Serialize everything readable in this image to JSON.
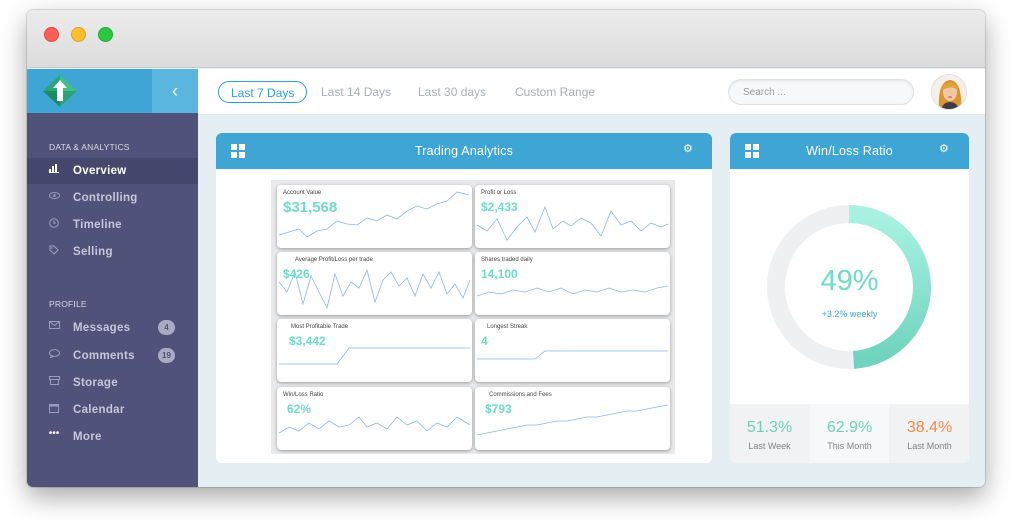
{
  "window": {
    "title": ""
  },
  "sidebar": {
    "sections": [
      {
        "label": "DATA & ANALYTICS",
        "items": [
          {
            "label": "Overview",
            "icon": "bar-chart-icon",
            "active": true
          },
          {
            "label": "Controlling",
            "icon": "eye-icon"
          },
          {
            "label": "Timeline",
            "icon": "clock-icon"
          },
          {
            "label": "Selling",
            "icon": "tag-icon"
          }
        ]
      },
      {
        "label": "PROFILE",
        "items": [
          {
            "label": "Messages",
            "icon": "envelope-icon",
            "badge": "4"
          },
          {
            "label": "Comments",
            "icon": "speech-bubble-icon",
            "badge": "19"
          },
          {
            "label": "Storage",
            "icon": "box-icon"
          },
          {
            "label": "Calendar",
            "icon": "calendar-icon"
          },
          {
            "label": "More",
            "icon": "ellipsis-icon"
          }
        ]
      }
    ],
    "collapse_icon": "‹"
  },
  "header": {
    "tabs": [
      {
        "label": "Last 7 Days",
        "active": true
      },
      {
        "label": "Last 14 Days"
      },
      {
        "label": "Last 30 days"
      },
      {
        "label": "Custom Range"
      }
    ],
    "search_placeholder": "Search ..."
  },
  "trading": {
    "title": "Trading Analytics",
    "cards": [
      {
        "label": "Account Value",
        "value": "$31,568"
      },
      {
        "label": "Profit or Loss",
        "value": "$2,433"
      },
      {
        "label": "Average Profit/Loss per trade",
        "value": "$426"
      },
      {
        "label": "Shares traded daily",
        "value": "14,100"
      },
      {
        "label": "Most Profitable Trade",
        "value": "$3,442"
      },
      {
        "label": "Longest Streak",
        "value": "4"
      },
      {
        "label": "Win/Loss Ratio",
        "value": "62%"
      },
      {
        "label": "Commissions and Fees",
        "value": "$793"
      }
    ]
  },
  "winloss": {
    "title": "Win/Loss Ratio",
    "percent_label": "49%",
    "percent_value": 49,
    "weekly": "+3.2% weekly",
    "stats": [
      {
        "value": "51.3%",
        "label": "Last Week",
        "color": "#6fcfb6"
      },
      {
        "value": "62.9%",
        "label": "This Month",
        "color": "#6fcfb6"
      },
      {
        "value": "38.4%",
        "label": "Last Month",
        "color": "#f28b4a"
      }
    ]
  },
  "colors": {
    "accent": "#3ea5d4",
    "sidebar": "#50527a",
    "teal": "#6fdcc7"
  }
}
